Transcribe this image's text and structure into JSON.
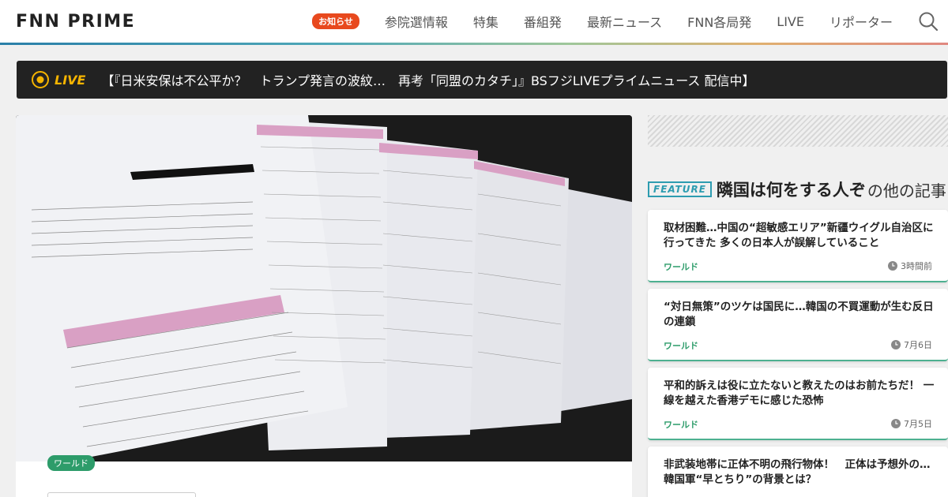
{
  "header": {
    "logo": "FNN PRIME",
    "badge": "お知らせ",
    "nav": [
      "参院選情報",
      "特集",
      "番組発",
      "最新ニュース",
      "FNN各局発",
      "LIVE",
      "リポーター"
    ],
    "search_icon": "search-icon"
  },
  "live": {
    "label": "LIVE",
    "text": "【『日米安保は不公平か？　トランプ発言の波紋…　再考「同盟のカタチ」』BSフジLIVEプライムニュース 配信中】"
  },
  "hero": {
    "category": "ワールド",
    "image": "photo of Korean strategic-goods export documents spread on a black surface"
  },
  "sidebar": {
    "feature_badge": "FEATURE",
    "feature_name": "隣国は何をする人ぞ",
    "feature_suffix": "の他の記事",
    "cards": [
      {
        "title": "取材困難…中国の“超敏感エリア”新疆ウイグル自治区に行ってきた 多くの日本人が誤解していること",
        "category": "ワールド",
        "time": "3時間前"
      },
      {
        "title": "“対日無策”のツケは国民に…韓国の不買運動が生む反日の連鎖",
        "category": "ワールド",
        "time": "7月6日"
      },
      {
        "title": "平和的訴えは役に立たないと教えたのはお前たちだ！ 一線を越えた香港デモに感じた恐怖",
        "category": "ワールド",
        "time": "7月5日"
      },
      {
        "title": "非武装地帯に正体不明の飛行物体！　正体は予想外の…韓国軍“早とちり”の背景とは？",
        "category": "",
        "time": ""
      }
    ]
  },
  "colors": {
    "accent_green": "#2d9c6a",
    "badge_red": "#e8491e",
    "live_yellow": "#f5b400",
    "feature_blue": "#2d9cb0"
  }
}
